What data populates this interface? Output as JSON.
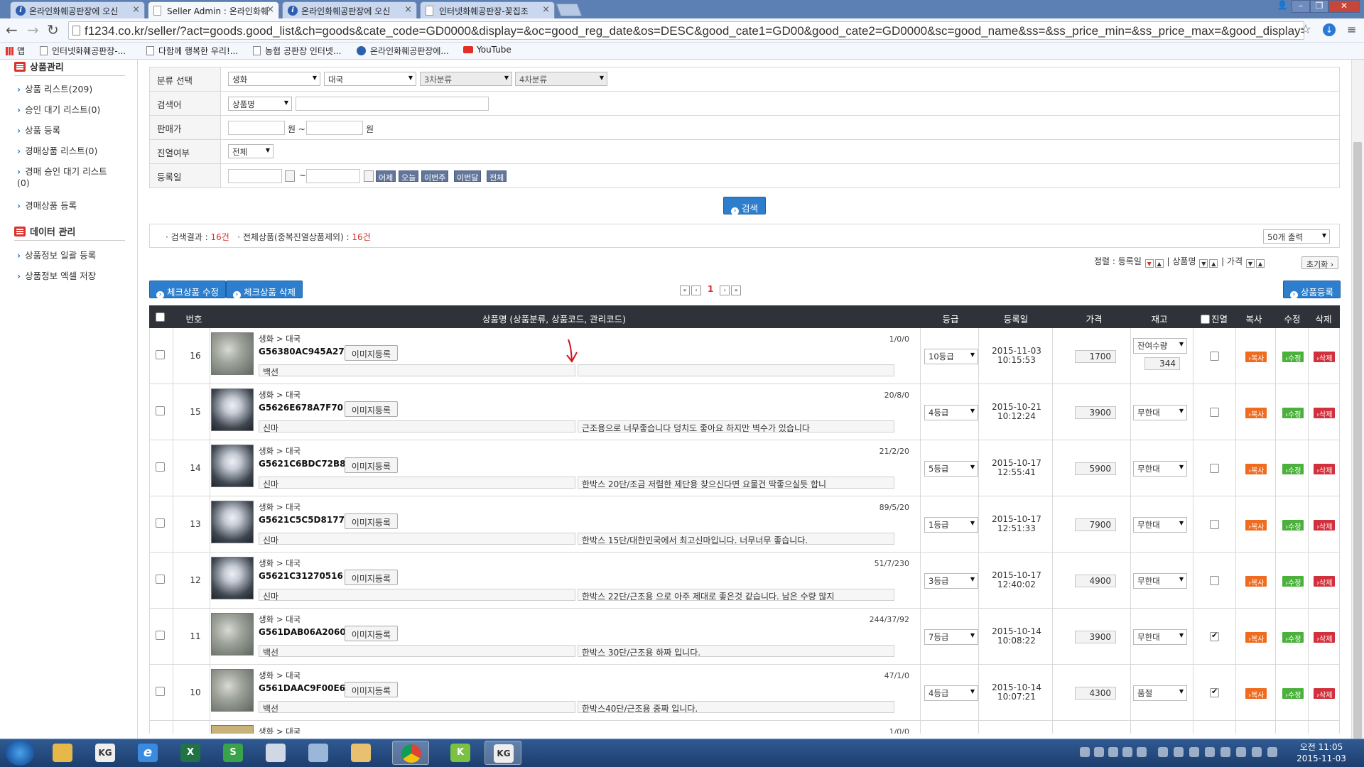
{
  "browser": {
    "tabs": [
      {
        "label": "온라인화훼공판장에 오신"
      },
      {
        "label": "Seller Admin : 온라인화훼"
      },
      {
        "label": "온라인화훼공판장에 오신"
      },
      {
        "label": "인터넷화훼공판장-꽃집조"
      }
    ],
    "url": "f1234.co.kr/seller/?act=goods.good_list&ch=goods&cate_code=GD0000&display=&oc=good_reg_date&os=DESC&good_cate1=GD00&good_cate2=GD0000&sc=good_name&ss=&ss_price_min=&ss_price_max=&good_display=&good",
    "bookmarks": [
      "앱",
      "인터넷화훼공판장-...",
      "다함께 행복한 우리!...",
      "농협 공판장 인터넷...",
      "온라인화훼공판장에...",
      "YouTube"
    ]
  },
  "sidebar": {
    "section1": "상품관리",
    "items1": [
      "상품 리스트(209)",
      "승인 대기 리스트(0)",
      "상품 등록",
      "경매상품 리스트(0)",
      "경매 승인 대기 리스트(0)",
      "경매상품 등록"
    ],
    "section2": "데이터 관리",
    "items2": [
      "상품정보 일괄 등록",
      "상품정보 엑셀 저장"
    ]
  },
  "search": {
    "labels": {
      "category": "분류 선택",
      "keyword": "검색어",
      "price": "판매가",
      "display": "진열여부",
      "regdate": "등록일"
    },
    "cat1": "생화",
    "cat2": "대국",
    "cat3": "3차분류",
    "cat4": "4차분류",
    "keyword_type": "상품명",
    "won1": "원 ~",
    "won2": "원",
    "display_value": "전체",
    "date_sep": "~",
    "date_buttons": [
      "어제",
      "오늘",
      "이번주",
      "이번달",
      "전체"
    ],
    "search_button": "검색"
  },
  "results": {
    "label1": "· 검색결과 :",
    "count1": "16건",
    "label2": "· 전체상품(중복진열상품제외) :",
    "count2": "16건",
    "per_page": "50개 출력",
    "sort_label": "정렬 : 등록일",
    "sort2": "| 상품명",
    "sort3": "| 가격",
    "reset": "초기화"
  },
  "toolbar": {
    "edit_checked": "체크상품 수정",
    "delete_checked": "체크상품 삭제",
    "register": "상품등록",
    "page_current": "1"
  },
  "table": {
    "headers": {
      "no": "번호",
      "name": "상품명 (상품분류, 상품코드, 관리코드)",
      "grade": "등급",
      "regdate": "등록일",
      "price": "가격",
      "stock": "재고",
      "display": "진열",
      "copy": "복사",
      "edit": "수정",
      "delete": "삭제"
    },
    "btn_image": "이미지등록",
    "btn_copy": "복사",
    "btn_edit": "수정",
    "btn_delete": "삭제",
    "rows": [
      {
        "no": "16",
        "cat": "생화 > 대국",
        "code": "G56380AC945A27",
        "stats": "1/0/0",
        "name": "백선",
        "desc": "",
        "grade": "10등급",
        "date": "2015-11-03",
        "time": "10:15:53",
        "price": "1700",
        "stock": "잔여수량",
        "stock_qty": "344",
        "displayed": false
      },
      {
        "no": "15",
        "cat": "생화 > 대국",
        "code": "G5626E678A7F70",
        "stats": "20/8/0",
        "name": "신마",
        "desc": "근조용으로 너무좋습니다 덩치도 좋아요 하지만 벽수가 있습니다",
        "grade": "4등급",
        "date": "2015-10-21",
        "time": "10:12:24",
        "price": "3900",
        "stock": "무한대",
        "displayed": false
      },
      {
        "no": "14",
        "cat": "생화 > 대국",
        "code": "G5621C6BDC72B8",
        "stats": "21/2/20",
        "name": "신마",
        "desc": "한박스 20단/조금 저렴한 제단용 찾으신다면 요물건 딱좋으실듯 합니",
        "grade": "5등급",
        "date": "2015-10-17",
        "time": "12:55:41",
        "price": "5900",
        "stock": "무한대",
        "displayed": false
      },
      {
        "no": "13",
        "cat": "생화 > 대국",
        "code": "G5621C5C5D8177",
        "stats": "89/5/20",
        "name": "신마",
        "desc": "한박스 15단/대한민국에서 최고신마입니다. 너무너무 좋습니다.",
        "grade": "1등급",
        "date": "2015-10-17",
        "time": "12:51:33",
        "price": "7900",
        "stock": "무한대",
        "displayed": false
      },
      {
        "no": "12",
        "cat": "생화 > 대국",
        "code": "G5621C31270516",
        "stats": "51/7/230",
        "name": "신마",
        "desc": "한박스 22단/근조용 으로 아주 제대로 좋은것 같습니다. 남은 수량 많지",
        "grade": "3등급",
        "date": "2015-10-17",
        "time": "12:40:02",
        "price": "4900",
        "stock": "무한대",
        "displayed": false
      },
      {
        "no": "11",
        "cat": "생화 > 대국",
        "code": "G561DAB06A2060",
        "stats": "244/37/92",
        "name": "백선",
        "desc": "한박스 30단/근조용 하짜 입니다.",
        "grade": "7등급",
        "date": "2015-10-14",
        "time": "10:08:22",
        "price": "3900",
        "stock": "무한대",
        "displayed": true
      },
      {
        "no": "10",
        "cat": "생화 > 대국",
        "code": "G561DAAC9F00E6",
        "stats": "47/1/0",
        "name": "백선",
        "desc": "한박스40단/근조용 중짜 입니다.",
        "grade": "4등급",
        "date": "2015-10-14",
        "time": "10:07:21",
        "price": "4300",
        "stock": "품절",
        "displayed": true
      }
    ],
    "partial_row": {
      "cat": "생화 > 대국",
      "stats": "1/0/0"
    }
  },
  "taskbar": {
    "time": "오전 11:05",
    "date": "2015-11-03",
    "apps": [
      "KG",
      "e",
      "X",
      "S",
      "K",
      "KG"
    ]
  }
}
